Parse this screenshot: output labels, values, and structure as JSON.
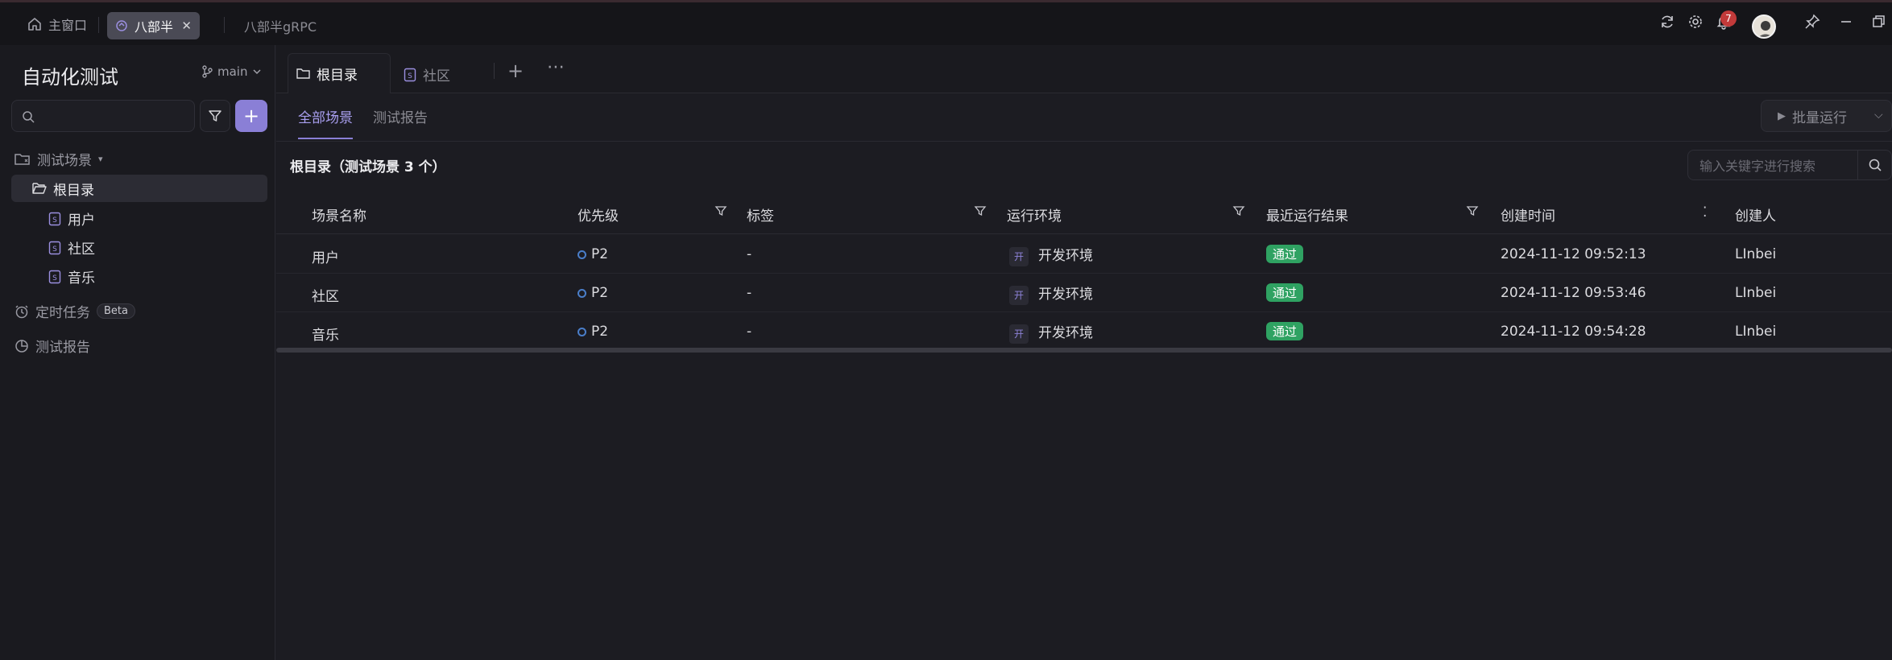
{
  "window": {
    "tabs": [
      {
        "label": "主窗口",
        "icon": "home-icon"
      },
      {
        "label": "八部半",
        "icon": "project-icon",
        "active": true
      },
      {
        "label": "八部半gRPC",
        "icon": "",
        "active": false
      }
    ],
    "notifications_count": "7"
  },
  "sidebar": {
    "project_title": "自动化测试",
    "branch": "main",
    "search": {
      "placeholder": "",
      "value": ""
    },
    "sections": {
      "scenes": "测试场景",
      "scheduled": "定时任务",
      "scheduled_badge": "Beta",
      "reports": "测试报告"
    },
    "tree": {
      "root": "根目录",
      "items": [
        "用户",
        "社区",
        "音乐"
      ]
    }
  },
  "main": {
    "doc_tabs": [
      {
        "label": "根目录",
        "active": true
      },
      {
        "label": "社区",
        "active": false
      }
    ],
    "sub_tabs": [
      "全部场景",
      "测试报告"
    ],
    "batch_run_label": "批量运行",
    "list_title": "根目录（测试场景 3 个）",
    "keyword_search_placeholder": "输入关键字进行搜索",
    "table": {
      "columns": [
        "场景名称",
        "优先级",
        "标签",
        "运行环境",
        "最近运行结果",
        "创建时间",
        "创建人"
      ],
      "rows": [
        {
          "name": "用户",
          "priority": "P2",
          "tag": "-",
          "env_chip": "开",
          "env": "开发环境",
          "result": "通过",
          "created": "2024-11-12 09:52:13",
          "creator": "LInbei"
        },
        {
          "name": "社区",
          "priority": "P2",
          "tag": "-",
          "env_chip": "开",
          "env": "开发环境",
          "result": "通过",
          "created": "2024-11-12 09:53:46",
          "creator": "LInbei"
        },
        {
          "name": "音乐",
          "priority": "P2",
          "tag": "-",
          "env_chip": "开",
          "env": "开发环境",
          "result": "通过",
          "created": "2024-11-12 09:54:28",
          "creator": "LInbei"
        }
      ]
    }
  },
  "colors": {
    "accent": "#8a7fd6",
    "pass": "#2fa262",
    "badge_red": "#c23a3a"
  }
}
